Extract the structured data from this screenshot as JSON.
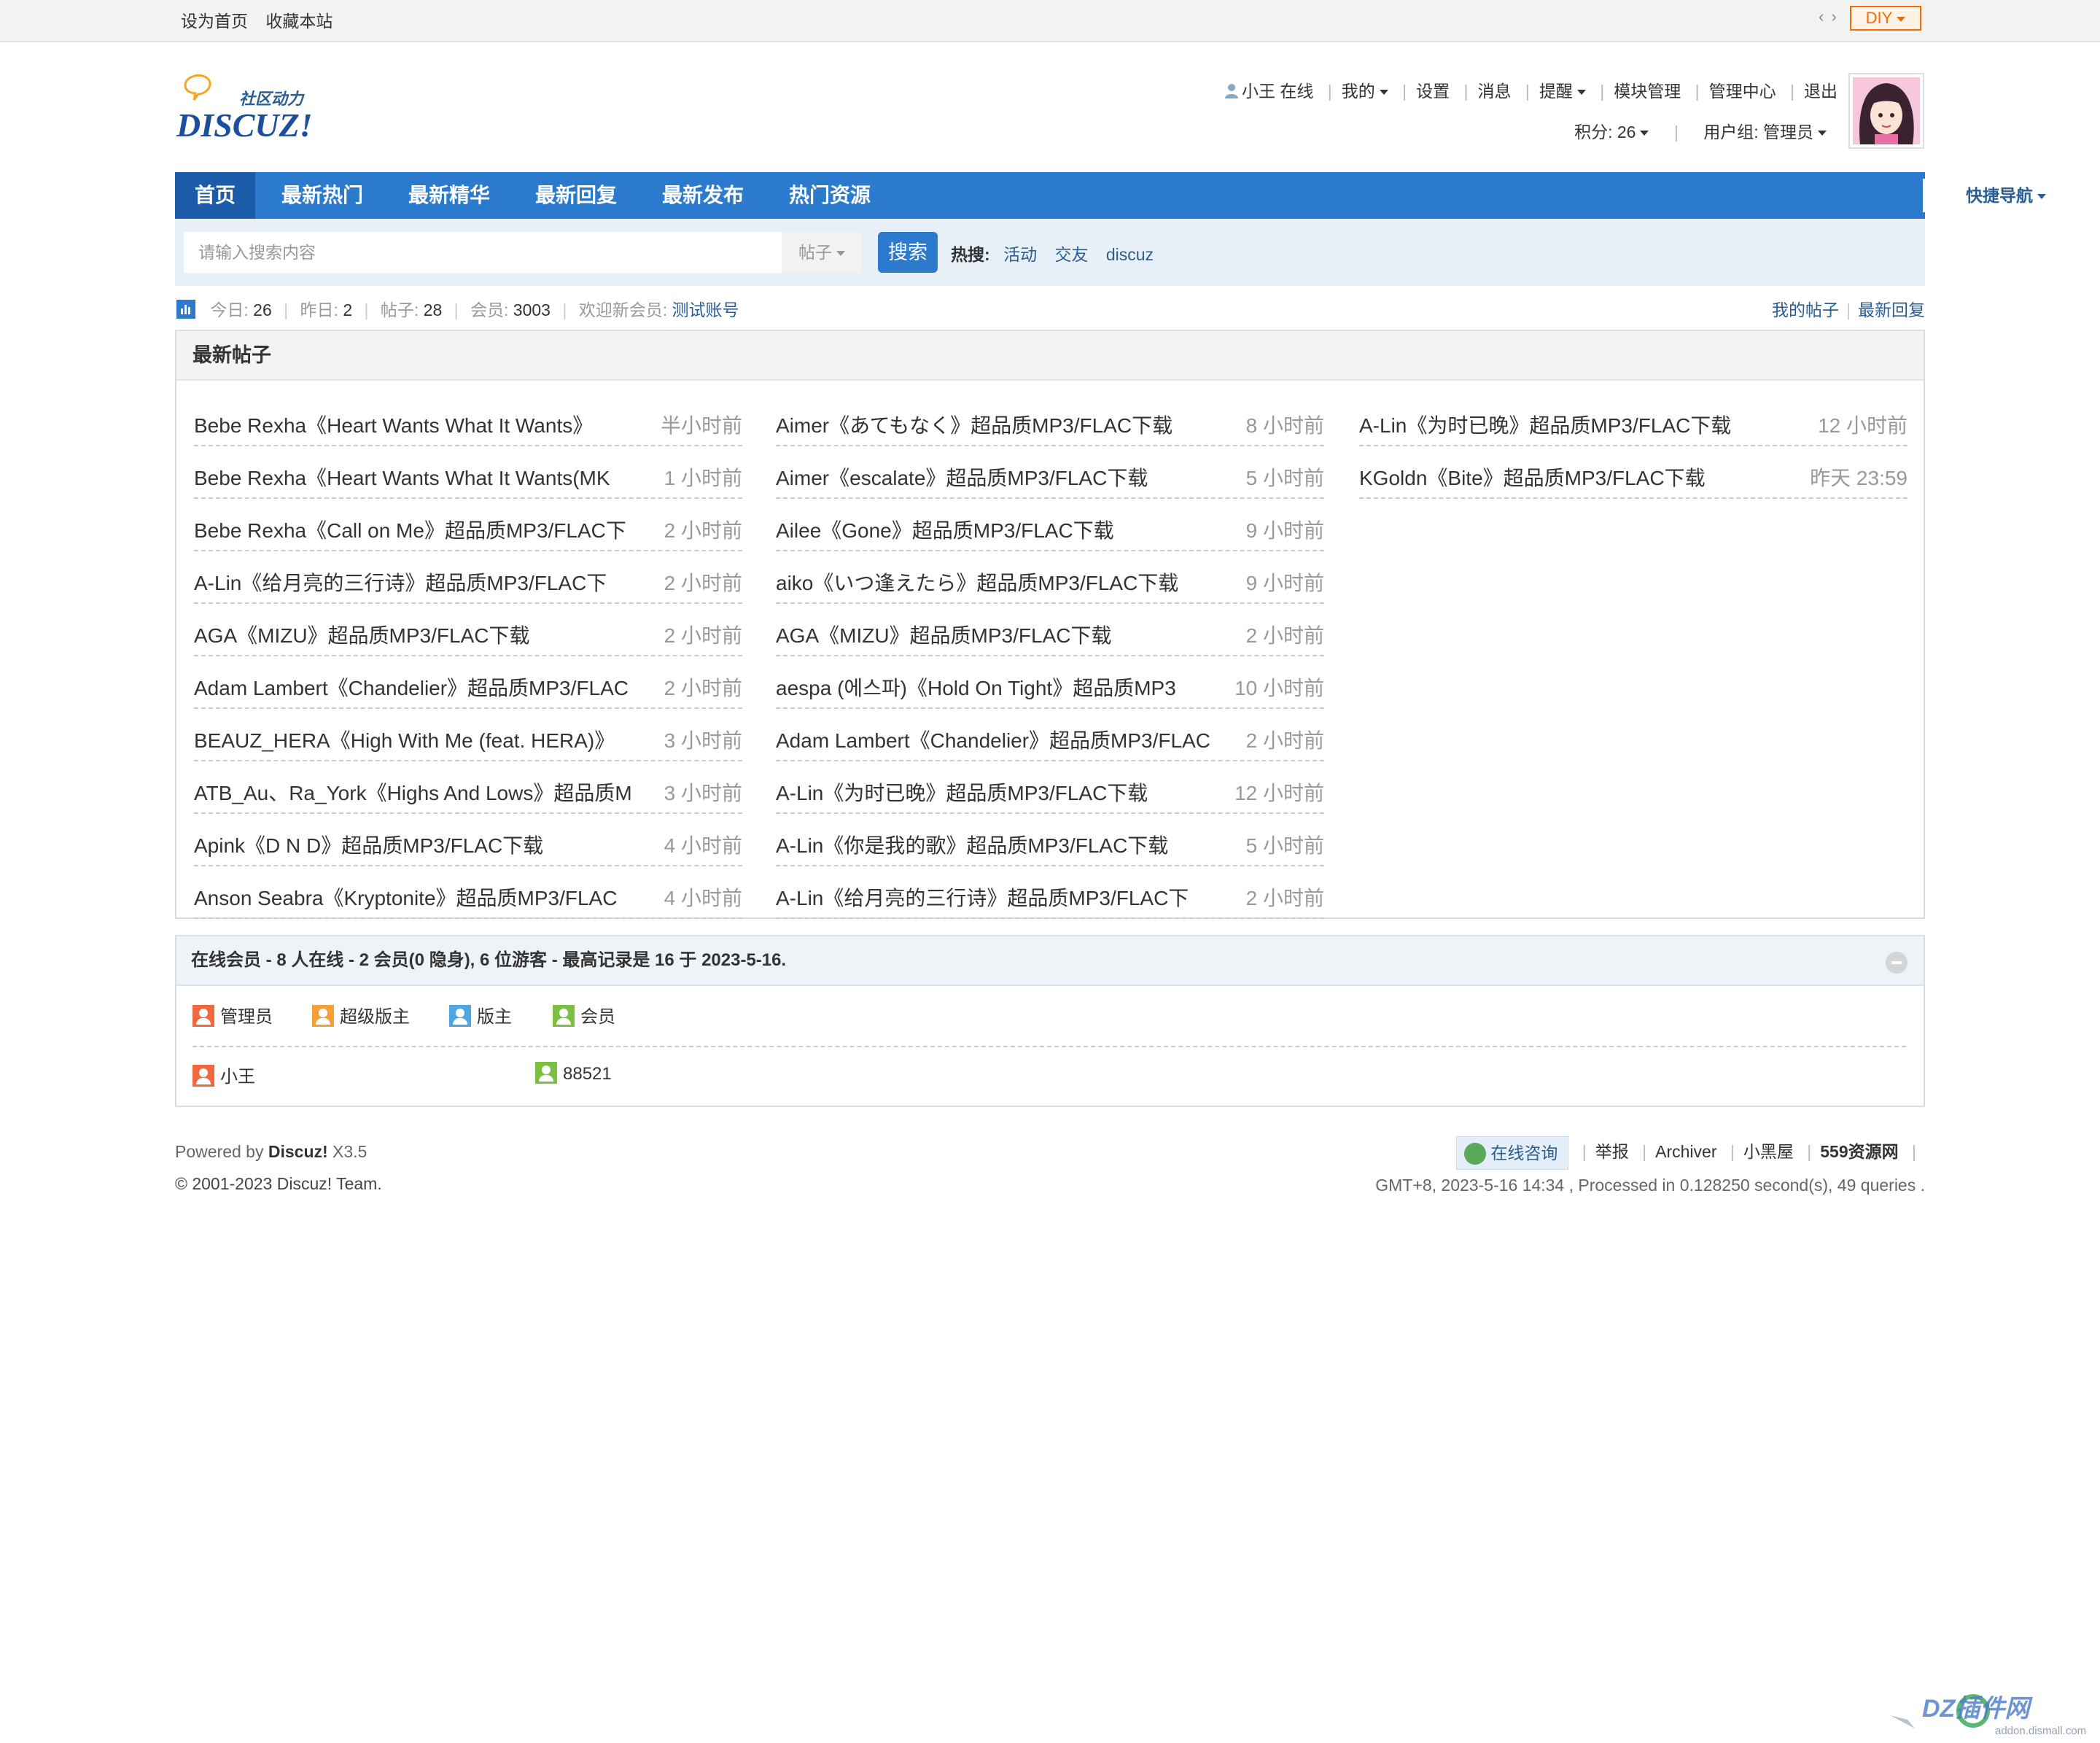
{
  "topbar": {
    "links": [
      "设为首页",
      "收藏本站"
    ],
    "diy_label": "DIY",
    "switch_glyph": "‹ ›"
  },
  "user_menu": {
    "user_label": "小王 在线",
    "items": [
      "我的",
      "设置",
      "消息",
      "提醒",
      "模块管理",
      "管理中心",
      "退出"
    ],
    "credits": "积分: 26",
    "group": "用户组: 管理员"
  },
  "logo": {
    "brand": "DISCUZ!",
    "tagline": "社区动力"
  },
  "nav": {
    "items": [
      "首页",
      "最新热门",
      "最新精华",
      "最新回复",
      "最新发布",
      "热门资源"
    ],
    "quick_nav": "快捷导航"
  },
  "search": {
    "placeholder": "请输入搜索内容",
    "type": "帖子",
    "button": "搜索",
    "hot_label": "热搜:",
    "hot_keywords": [
      "活动",
      "交友",
      "discuz"
    ]
  },
  "stats": {
    "today_label": "今日:",
    "today": "26",
    "yesterday_label": "昨日:",
    "yesterday": "2",
    "posts_label": "帖子:",
    "posts": "28",
    "members_label": "会员:",
    "members": "3003",
    "welcome_label": "欢迎新会员:",
    "new_member": "测试账号",
    "links": [
      "我的帖子",
      "最新回复"
    ]
  },
  "latest": {
    "title": "最新帖子",
    "columns": [
      [
        {
          "title": "Bebe Rexha《Heart Wants What It Wants》",
          "time": "半小时前"
        },
        {
          "title": "Bebe Rexha《Heart Wants What It Wants(MK",
          "time": "1 小时前"
        },
        {
          "title": "Bebe Rexha《Call on Me》超品质MP3/FLAC下",
          "time": "2 小时前"
        },
        {
          "title": "A-Lin《给月亮的三行诗》超品质MP3/FLAC下",
          "time": "2 小时前"
        },
        {
          "title": "AGA《MIZU》超品质MP3/FLAC下载",
          "time": "2 小时前"
        },
        {
          "title": "Adam Lambert《Chandelier》超品质MP3/FLAC",
          "time": "2 小时前"
        },
        {
          "title": "BEAUZ_HERA《High With Me (feat. HERA)》",
          "time": "3 小时前"
        },
        {
          "title": "ATB_Au、Ra_York《Highs And Lows》超品质M",
          "time": "3 小时前"
        },
        {
          "title": "Apink《D N D》超品质MP3/FLAC下载",
          "time": "4 小时前"
        },
        {
          "title": "Anson Seabra《Kryptonite》超品质MP3/FLAC",
          "time": "4 小时前"
        }
      ],
      [
        {
          "title": "Aimer《あてもなく》超品质MP3/FLAC下载",
          "time": "8 小时前"
        },
        {
          "title": "Aimer《escalate》超品质MP3/FLAC下载",
          "time": "5 小时前"
        },
        {
          "title": "Ailee《Gone》超品质MP3/FLAC下载",
          "time": "9 小时前"
        },
        {
          "title": "aiko《いつ逢えたら》超品质MP3/FLAC下载",
          "time": "9 小时前"
        },
        {
          "title": "AGA《MIZU》超品质MP3/FLAC下载",
          "time": "2 小时前"
        },
        {
          "title": "aespa (에스파)《Hold On Tight》超品质MP3",
          "time": "10 小时前"
        },
        {
          "title": "Adam Lambert《Chandelier》超品质MP3/FLAC",
          "time": "2 小时前"
        },
        {
          "title": "A-Lin《为时已晚》超品质MP3/FLAC下载",
          "time": "12 小时前"
        },
        {
          "title": "A-Lin《你是我的歌》超品质MP3/FLAC下载",
          "time": "5 小时前"
        },
        {
          "title": "A-Lin《给月亮的三行诗》超品质MP3/FLAC下",
          "time": "2 小时前"
        }
      ],
      [
        {
          "title": "A-Lin《为时已晚》超品质MP3/FLAC下载",
          "time": "12 小时前"
        },
        {
          "title": "KGoldn《Bite》超品质MP3/FLAC下载",
          "time": "昨天 23:59"
        }
      ]
    ]
  },
  "online": {
    "header": "在线会员 - 8 人在线 - 2 会员(0 隐身), 6 位游客 - 最高记录是 16 于 2023-5-16.",
    "legend": [
      {
        "label": "管理员",
        "color": "#f0683f"
      },
      {
        "label": "超级版主",
        "color": "#f5a13a"
      },
      {
        "label": "版主",
        "color": "#4fa6e0"
      },
      {
        "label": "会员",
        "color": "#7bc043"
      }
    ],
    "users": [
      {
        "name": "小王",
        "color": "#f0683f"
      },
      {
        "name": "88521",
        "color": "#7bc043"
      }
    ]
  },
  "footer": {
    "powered_prefix": "Powered by",
    "powered_brand": "Discuz!",
    "powered_version": "X3.5",
    "copyright": "© 2001-2023 Discuz! Team.",
    "consult": "在线咨询",
    "links": [
      "举报",
      "Archiver",
      "小黑屋",
      "559资源网"
    ],
    "info": "GMT+8, 2023-5-16 14:34 , Processed in 0.128250 second(s), 49 queries ."
  },
  "watermark": {
    "text": "DZ插件网",
    "url_text": "addon.dismall.com"
  },
  "colors": {
    "nav": "#2b7acd",
    "nav_active": "#1b5ba8",
    "link": "#2b5e93",
    "diy": "#f26c00"
  }
}
